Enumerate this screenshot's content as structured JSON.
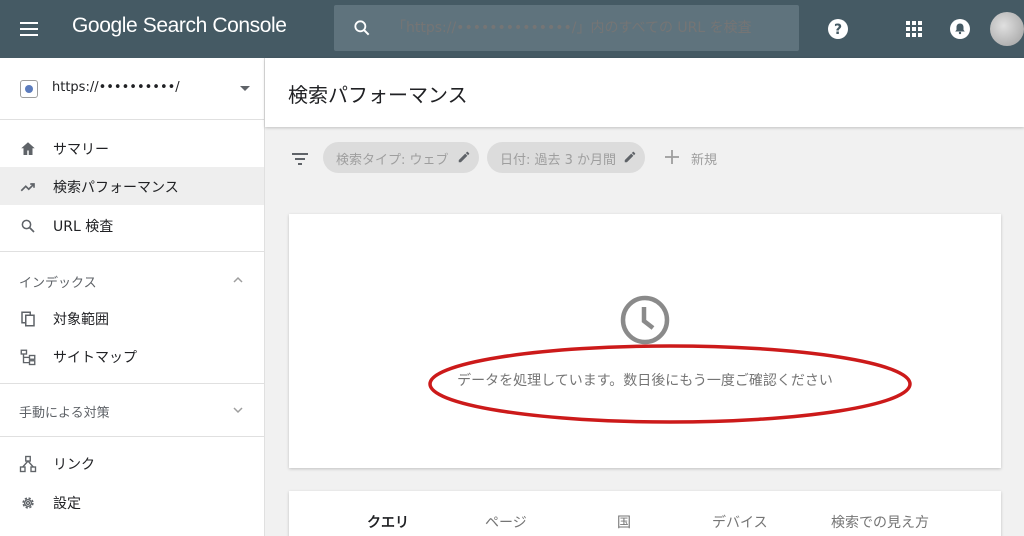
{
  "topbar": {
    "brand": "Google Search Console",
    "search_placeholder": "「https://••••••••••••••/」内のすべての URL を検査",
    "icons": [
      "menu-icon",
      "search-icon",
      "help-icon",
      "apps-icon",
      "bell-icon"
    ],
    "color": "#455a64"
  },
  "sidebar": {
    "property": "https://••••••••••/",
    "items": [
      {
        "label": "サマリー",
        "icon": "home-icon"
      },
      {
        "label": "検索パフォーマンス",
        "icon": "trending-icon",
        "active": true
      },
      {
        "label": "URL 検査",
        "icon": "search-icon"
      }
    ],
    "index_section": {
      "label": "インデックス",
      "items": [
        {
          "label": "対象範囲",
          "icon": "copy-icon"
        },
        {
          "label": "サイトマップ",
          "icon": "sitemap-icon"
        }
      ]
    },
    "manual_section": {
      "label": "手動による対策"
    },
    "bottom_items": [
      {
        "label": "リンク",
        "icon": "links-icon"
      },
      {
        "label": "設定",
        "icon": "gear-icon"
      }
    ]
  },
  "main": {
    "title": "検索パフォーマンス",
    "filters": {
      "search_type": "検索タイプ: ウェブ",
      "date": "日付: 過去 3 か月間",
      "new_label": "新規"
    },
    "processing_message": "データを処理しています。数日後にもう一度ご確認ください",
    "tabs": [
      "クエリ",
      "ページ",
      "国",
      "デバイス",
      "検索での見え方"
    ]
  },
  "colors": {
    "annotation": "#cc1a1a",
    "active_nav_bg": "#eeeeee"
  }
}
